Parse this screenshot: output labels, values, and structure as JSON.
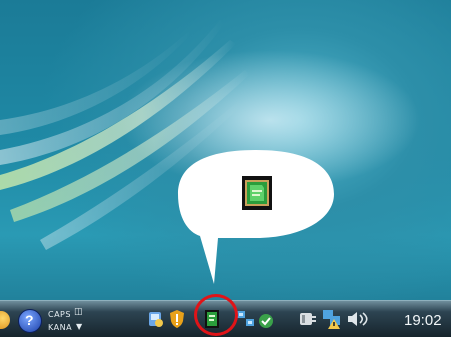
{
  "taskbar": {
    "caps_label": "CAPS",
    "kana_label": "KANA",
    "clock": "19:02"
  },
  "icons": [
    "start-orb-icon",
    "help-icon",
    "caps-icon",
    "kana-dropdown-icon",
    "network-manager-icon",
    "shield-warning-icon",
    "phone-sync-icon",
    "network-icon",
    "security-check-icon",
    "power-plug-icon",
    "network-warning-icon",
    "volume-icon"
  ],
  "colors": {
    "highlight_ring": "#e01418",
    "callout_fill": "#ffffff",
    "taskbar_dark": "#16242c",
    "desktop_teal": "#1f8aa6"
  }
}
